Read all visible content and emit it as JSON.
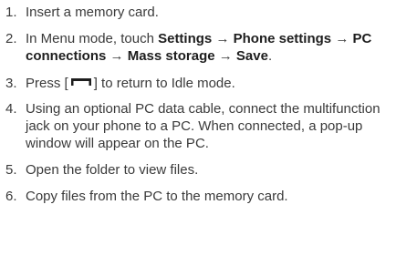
{
  "steps": [
    {
      "number": "1.",
      "text": "Insert a memory card."
    },
    {
      "number": "2.",
      "pre": "In Menu mode, touch ",
      "path": [
        "Settings",
        "Phone settings",
        "PC connections",
        "Mass storage",
        "Save"
      ],
      "arrow": "→",
      "post": "."
    },
    {
      "number": "3.",
      "pre": "Press [",
      "icon": "menu-key-icon",
      "post": "] to return to Idle mode."
    },
    {
      "number": "4.",
      "text": "Using an optional PC data cable, connect the multifunction jack on your phone to a PC. When connected, a pop-up window will appear on the PC."
    },
    {
      "number": "5.",
      "text": "Open the folder to view files."
    },
    {
      "number": "6.",
      "text": "Copy files from the PC to the memory card."
    }
  ]
}
